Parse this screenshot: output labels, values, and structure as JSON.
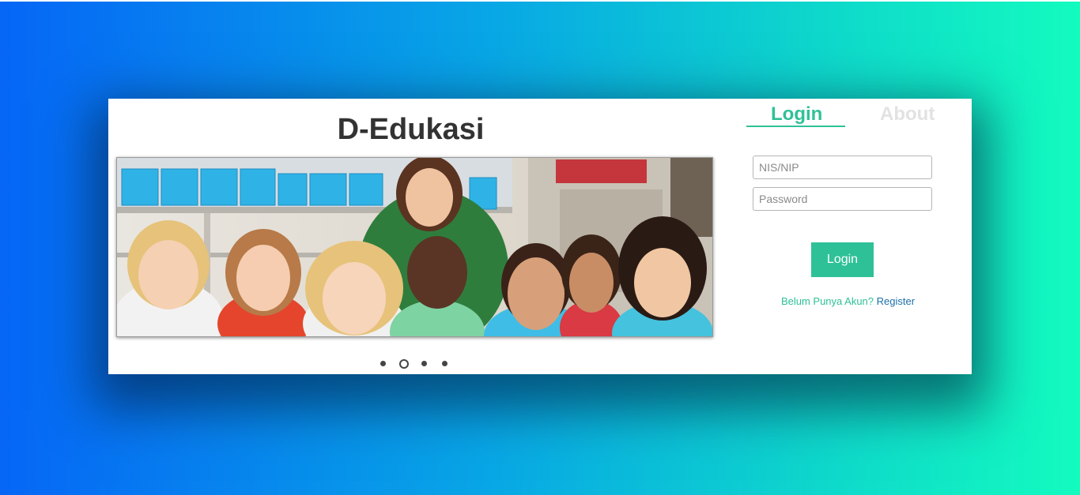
{
  "app": {
    "title": "D-Edukasi"
  },
  "colors": {
    "accent": "#2ec197",
    "link": "#1b6fa8",
    "title": "#333333",
    "inactive_tab": "#e2e2e2"
  },
  "slider": {
    "image": "children-classroom-photo",
    "slide_count": 4,
    "active_slide": 2
  },
  "tabs": [
    {
      "label": "Login",
      "active": true
    },
    {
      "label": "About",
      "active": false
    }
  ],
  "form": {
    "nis_placeholder": "NIS/NIP",
    "nis_value": "",
    "password_placeholder": "Password",
    "password_value": "",
    "login_label": "Login",
    "register_question": "Belum Punya Akun?",
    "register_link": "Register"
  }
}
